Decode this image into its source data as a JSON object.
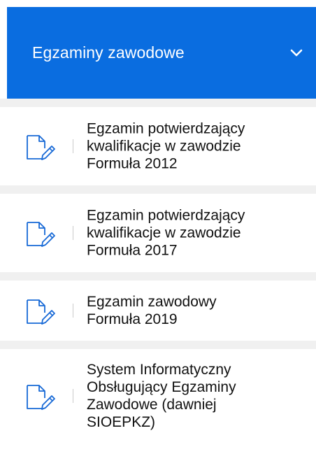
{
  "header": {
    "title": "Egzaminy zawodowe",
    "toggle_icon": "chevron-down-icon"
  },
  "items": [
    {
      "label_lines": [
        "Egzamin potwierdzający",
        "kwalifikacje w zawodzie",
        "Formuła 2012"
      ],
      "icon": "document-edit-icon"
    },
    {
      "label_lines": [
        "Egzamin potwierdzający",
        "kwalifikacje w zawodzie",
        "Formuła 2017"
      ],
      "icon": "document-edit-icon"
    },
    {
      "label_lines": [
        "Egzamin zawodowy",
        "Formuła 2019"
      ],
      "icon": "document-edit-icon"
    },
    {
      "label_lines": [
        "System Informatyczny",
        "Obsługujący Egzaminy",
        "Zawodowe (dawniej",
        "SIOEPKZ)"
      ],
      "icon": "document-edit-icon"
    }
  ],
  "colors": {
    "accent": "#0a6de0",
    "icon": "#1769d6",
    "separator": "#f0f0f0"
  }
}
